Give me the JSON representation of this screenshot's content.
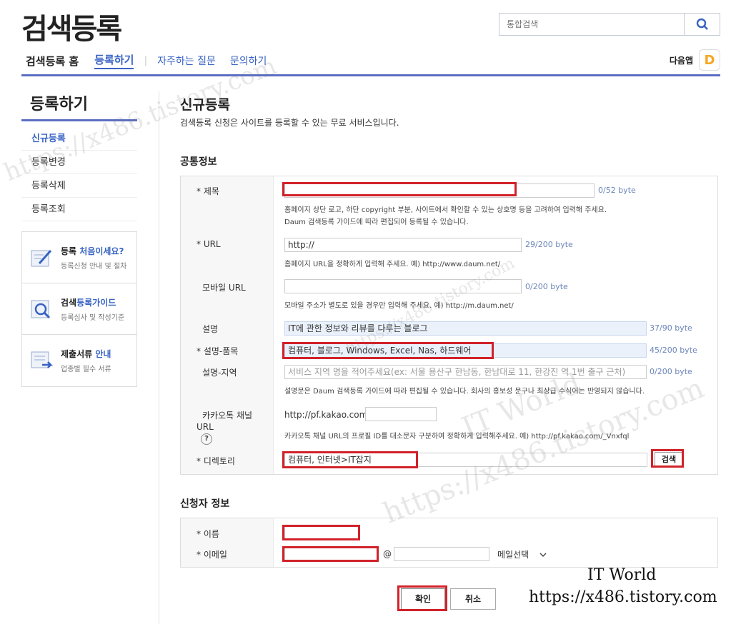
{
  "header": {
    "logo": "검색등록",
    "search_placeholder": "통합검색",
    "nav_home": "검색등록 홈",
    "nav_active": "등록하기",
    "nav_faq": "자주하는 질문",
    "nav_contact": "문의하기",
    "daum_app": "다음앱",
    "daum_app_letter": "D"
  },
  "sidebar": {
    "title": "등록하기",
    "items": [
      "신규등록",
      "등록변경",
      "등록삭제",
      "등록조회"
    ],
    "boxes": [
      {
        "pre": "등록 ",
        "hl": "처음이세요?",
        "sub": "등록신청 안내 및 절차"
      },
      {
        "pre": "검색",
        "hl": "등록가이드",
        "sub": "등록심사 및 작성기준"
      },
      {
        "pre": "제출서류 ",
        "hl": "안내",
        "sub": "업종별 필수 서류"
      }
    ]
  },
  "main": {
    "title": "신규등록",
    "desc": "검색등록 신청은 사이트를 등록할 수 있는 무료 서비스입니다.",
    "common_title": "공통정보",
    "applicant_title": "신청자 정보"
  },
  "form": {
    "title_label": "* 제목",
    "title_count": "0/52 byte",
    "title_help1": "홈페이지 상단 로고, 하단 copyright 부분, 사이트에서 확인할 수 있는 상호명 등을 고려하여 입력해 주세요.",
    "title_help2": "Daum 검색등록 가이드에 따라 편집되어 등록될 수 있습니다.",
    "url_label": "* URL",
    "url_value": "http://",
    "url_count": "29/200 byte",
    "url_help": "홈페이지 URL을 정확하게 입력해 주세요. 예) http://www.daum.net/",
    "mobile_label": "모바일 URL",
    "mobile_count": "0/200 byte",
    "mobile_help": "모바일 주소가 별도로 있을 경우만 입력해 주세요. 예) http://m.daum.net/",
    "desc_label": "설명",
    "desc_value": "IT에 관한 정보와 리뷰를 다루는 블로그",
    "desc_count": "37/90 byte",
    "desc_item_label": "* 설명-품목",
    "desc_item_value": "컴퓨터, 블로그, Windows, Excel, Nas, 하드웨어",
    "desc_item_count": "45/200 byte",
    "desc_region_label": "설명-지역",
    "desc_region_placeholder": "서비스 지역 명을 적어주세요(ex: 서울  용산구 한남동, 한남대로 11, 한강진 역 1번 출구 근처)",
    "desc_region_count": "0/200 byte",
    "desc_help": "설명문은 Daum 검색등록 가이드에 따라 편집될 수 있습니다. 회사의 홍보성 문구나 최상급 수식어는 반영되지 않습니다.",
    "kakao_label1": "카카오톡 채널",
    "kakao_label2": "URL",
    "kakao_prefix": "http://pf.kakao.com/",
    "kakao_help": "카카오톡 채널 URL의 프로필 ID를 대소문자 구분하여 정확하게 입력해주세요. 예) http://pf.kakao.com/_Vnxfql",
    "qmark": "?",
    "dir_label": "* 디렉토리",
    "dir_value": "컴퓨터, 인터넷>IT잡지",
    "dir_search_btn": "검색",
    "name_label": "* 이름",
    "email_label": "* 이메일",
    "email_at": "@",
    "email_select": "메일선택"
  },
  "buttons": {
    "ok": "확인",
    "cancel": "취소"
  },
  "watermark": {
    "line1": "IT World",
    "line2": "https://x486.tistory.com"
  },
  "colors": {
    "accent": "#3863c3",
    "highlight_red": "#d1222a",
    "nav_line": "#5b6ec2"
  }
}
